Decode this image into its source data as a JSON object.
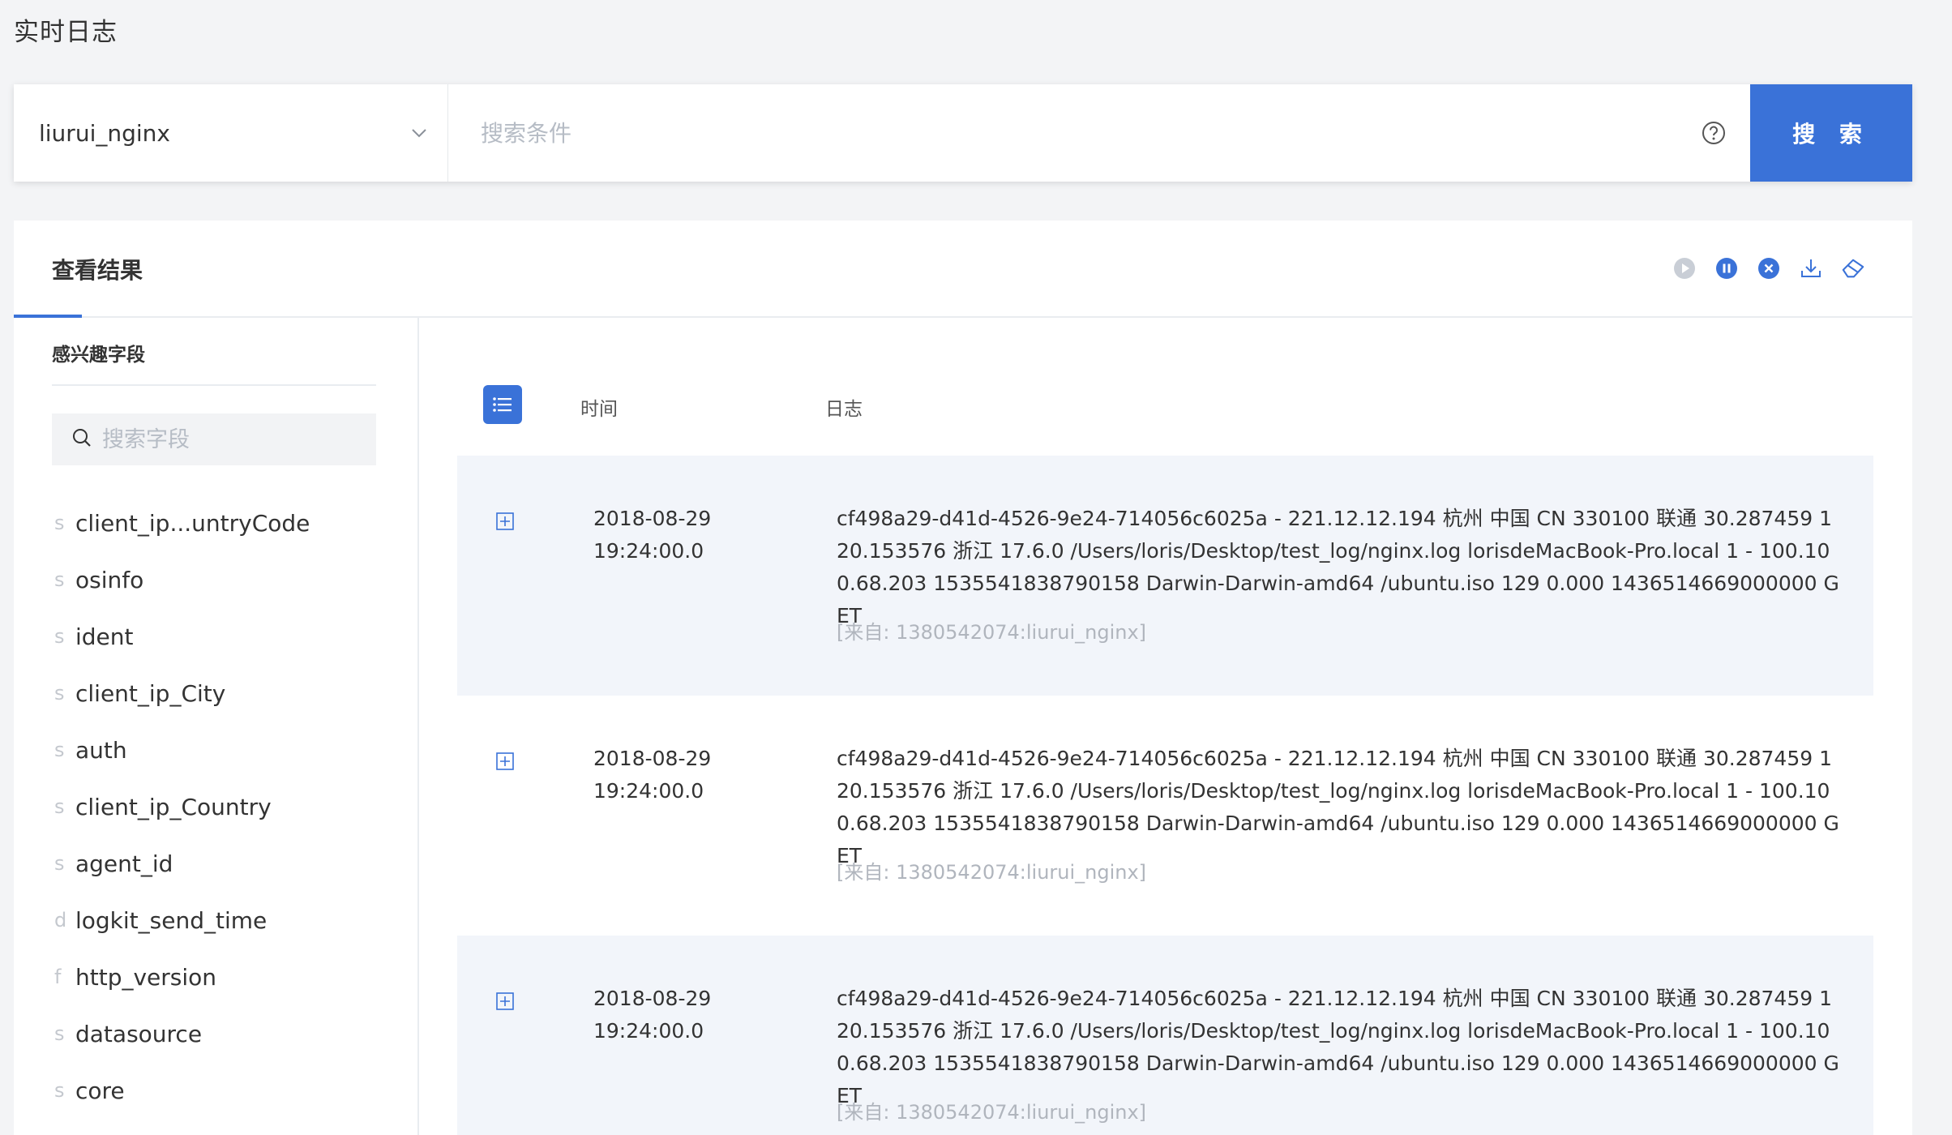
{
  "page": {
    "title": "实时日志"
  },
  "search": {
    "source_value": "liurui_nginx",
    "query_value": "",
    "query_placeholder": "搜索条件",
    "button_label": "搜 索"
  },
  "results": {
    "title": "查看结果",
    "toolbar": [
      "play-icon",
      "pause-icon",
      "close-icon",
      "download-icon",
      "eraser-icon"
    ]
  },
  "sidebar": {
    "title": "感兴趣字段",
    "search_placeholder": "搜索字段",
    "fields": [
      {
        "type": "s",
        "name": "client_ip...untryCode"
      },
      {
        "type": "s",
        "name": "osinfo"
      },
      {
        "type": "s",
        "name": "ident"
      },
      {
        "type": "s",
        "name": "client_ip_City"
      },
      {
        "type": "s",
        "name": "auth"
      },
      {
        "type": "s",
        "name": "client_ip_Country"
      },
      {
        "type": "s",
        "name": "agent_id"
      },
      {
        "type": "d",
        "name": "logkit_send_time"
      },
      {
        "type": "f",
        "name": "http_version"
      },
      {
        "type": "s",
        "name": "datasource"
      },
      {
        "type": "s",
        "name": "core"
      }
    ]
  },
  "table": {
    "col_time": "时间",
    "col_log": "日志",
    "rows": [
      {
        "date": "2018-08-29",
        "time": "19:24:00.0",
        "log": "cf498a29-d41d-4526-9e24-714056c6025a - 221.12.12.194 杭州 中国 CN 330100 联通 30.287459 120.153576 浙江 17.6.0 /Users/loris/Desktop/test_log/nginx.log lorisdeMacBook-Pro.local 1 - 100.100.68.203 1535541838790158 Darwin-Darwin-amd64 /ubuntu.iso 129 0.000 1436514669000000 GET",
        "source": "[来自: 1380542074:liurui_nginx]"
      },
      {
        "date": "2018-08-29",
        "time": "19:24:00.0",
        "log": "cf498a29-d41d-4526-9e24-714056c6025a - 221.12.12.194 杭州 中国 CN 330100 联通 30.287459 120.153576 浙江 17.6.0 /Users/loris/Desktop/test_log/nginx.log lorisdeMacBook-Pro.local 1 - 100.100.68.203 1535541838790158 Darwin-Darwin-amd64 /ubuntu.iso 129 0.000 1436514669000000 GET",
        "source": "[来自: 1380542074:liurui_nginx]"
      },
      {
        "date": "2018-08-29",
        "time": "19:24:00.0",
        "log": "cf498a29-d41d-4526-9e24-714056c6025a - 221.12.12.194 杭州 中国 CN 330100 联通 30.287459 120.153576 浙江 17.6.0 /Users/loris/Desktop/test_log/nginx.log lorisdeMacBook-Pro.local 1 - 100.100.68.203 1535541838790158 Darwin-Darwin-amd64 /ubuntu.iso 129 0.000 1436514669000000 GET",
        "source": "[来自: 1380542074:liurui_nginx]"
      }
    ]
  },
  "colors": {
    "accent": "#3a72d8",
    "muted": "#b0b5bd",
    "row_shade": "#f2f5fa"
  }
}
